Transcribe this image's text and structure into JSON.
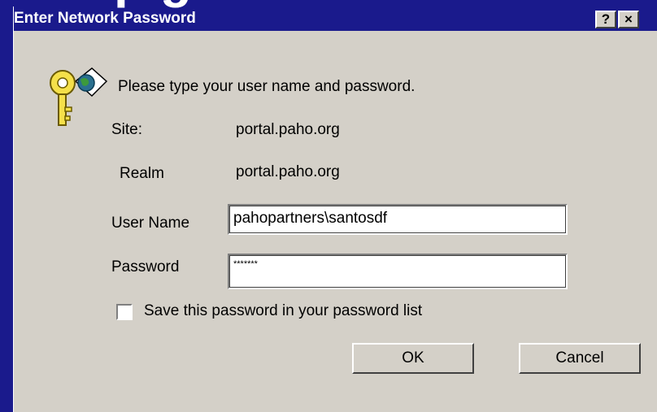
{
  "slide": {
    "title_fragment": "p     g"
  },
  "window": {
    "title": "Enter Network Password",
    "help_label": "?",
    "close_label": "×"
  },
  "dialog": {
    "icon": "key-globe-icon",
    "prompt": "Please type your user name and password.",
    "site_label": "Site:",
    "site_value": "portal.paho.org",
    "realm_label": "Realm",
    "realm_value": "portal.paho.org",
    "username_label": "User Name",
    "username_value": "pahopartners\\santosdf",
    "password_label": "Password",
    "password_value": "*******",
    "save_password_label": "Save this password in your password list",
    "save_password_checked": false,
    "ok_label": "OK",
    "cancel_label": "Cancel"
  },
  "colors": {
    "slide_background": "#1a1a8c",
    "dialog_background": "#d4d0c8",
    "titlebar": "#1a1a8c"
  }
}
